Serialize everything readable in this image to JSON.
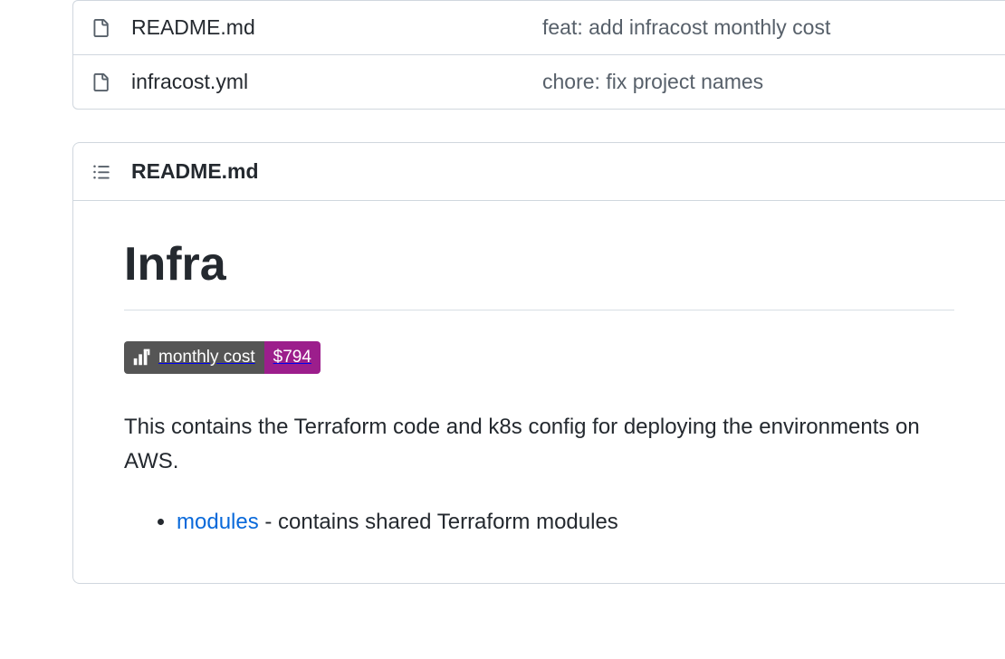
{
  "files": [
    {
      "name": "README.md",
      "commit": "feat: add infracost monthly cost"
    },
    {
      "name": "infracost.yml",
      "commit": "chore: fix project names"
    }
  ],
  "readme": {
    "filename": "README.md",
    "heading": "Infra",
    "badge": {
      "label": "monthly cost",
      "value": "$794"
    },
    "intro": "This contains the Terraform code and k8s config for deploying the environments on AWS.",
    "list": [
      {
        "link": "modules",
        "rest": " - contains shared Terraform modules"
      }
    ]
  }
}
